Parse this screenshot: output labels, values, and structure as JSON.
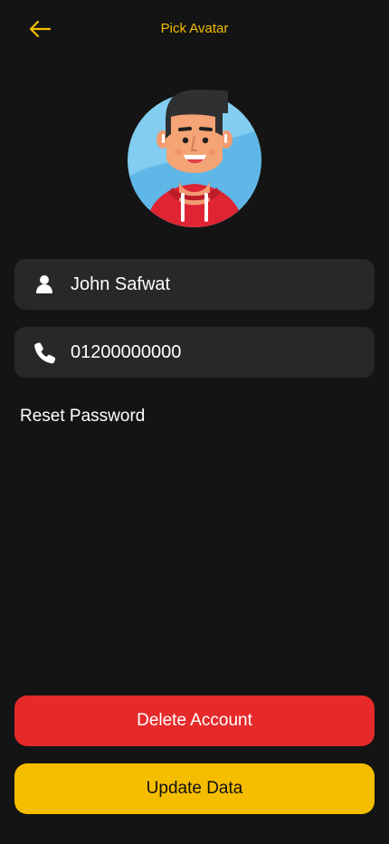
{
  "header": {
    "back_icon": "back-arrow-icon",
    "title": "Pick Avatar"
  },
  "avatar": {
    "icon": "avatar-image"
  },
  "profile": {
    "name": {
      "icon": "person-icon",
      "value": "John Safwat"
    },
    "phone": {
      "icon": "phone-icon",
      "value": "01200000000"
    }
  },
  "links": {
    "reset_password": "Reset Password"
  },
  "actions": {
    "delete_label": "Delete Account",
    "update_label": "Update Data"
  },
  "colors": {
    "background": "#141414",
    "field_background": "#272827",
    "accent": "#f5bd00",
    "danger": "#e62a2a"
  }
}
